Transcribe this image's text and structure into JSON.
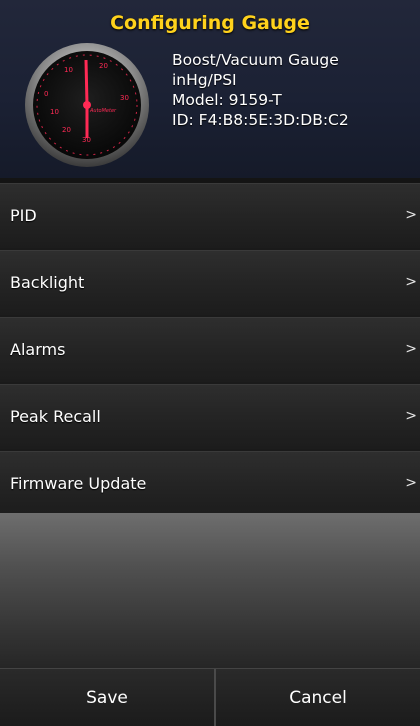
{
  "header": {
    "title": "Configuring Gauge"
  },
  "gauge": {
    "name": "Boost/Vacuum Gauge",
    "units": "inHg/PSI",
    "model": "Model: 9159-T",
    "id": "ID: F4:B8:5E:3D:DB:C2",
    "brand": "AutoMeter",
    "ticks": [
      "10",
      "20",
      "30",
      "0",
      "10",
      "20",
      "30"
    ],
    "accent_color": "#ff2a55"
  },
  "menu": {
    "items": [
      {
        "label": "PID",
        "chevron": ">"
      },
      {
        "label": "Backlight",
        "chevron": ">"
      },
      {
        "label": "Alarms",
        "chevron": ">"
      },
      {
        "label": "Peak Recall",
        "chevron": ">"
      },
      {
        "label": "Firmware Update",
        "chevron": ">"
      }
    ]
  },
  "footer": {
    "save_label": "Save",
    "cancel_label": "Cancel"
  }
}
